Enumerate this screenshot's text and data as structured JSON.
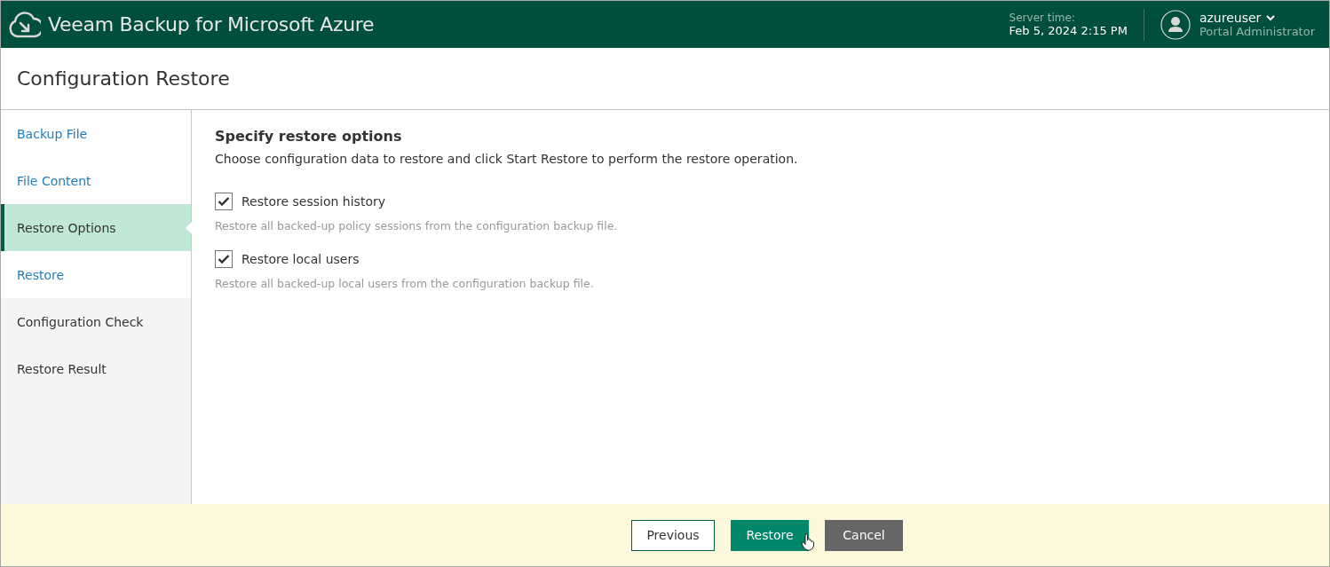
{
  "header": {
    "product": "Veeam Backup for Microsoft Azure",
    "server_time_label": "Server time:",
    "server_time": "Feb 5, 2024 2:15 PM",
    "user": {
      "name": "azureuser",
      "role": "Portal Administrator"
    }
  },
  "page_title": "Configuration Restore",
  "steps": [
    {
      "label": "Backup File",
      "selected": false,
      "available": true
    },
    {
      "label": "File Content",
      "selected": false,
      "available": true
    },
    {
      "label": "Restore Options",
      "selected": true,
      "available": true
    },
    {
      "label": "Restore",
      "selected": false,
      "available": true
    },
    {
      "label": "Configuration Check",
      "selected": false,
      "available": false
    },
    {
      "label": "Restore Result",
      "selected": false,
      "available": false
    }
  ],
  "content": {
    "heading": "Specify restore options",
    "description": "Choose configuration data to restore and click Start Restore to perform the restore operation.",
    "options": [
      {
        "label": "Restore session history",
        "checked": true,
        "hint": "Restore all backed-up policy sessions from the configuration backup file."
      },
      {
        "label": "Restore local users",
        "checked": true,
        "hint": "Restore all backed-up local users from the configuration backup file."
      }
    ]
  },
  "buttons": [
    {
      "label": "Previous",
      "kind": "secondary"
    },
    {
      "label": "Restore",
      "kind": "primary",
      "hovered": true
    },
    {
      "label": "Cancel",
      "kind": "neutral"
    }
  ]
}
